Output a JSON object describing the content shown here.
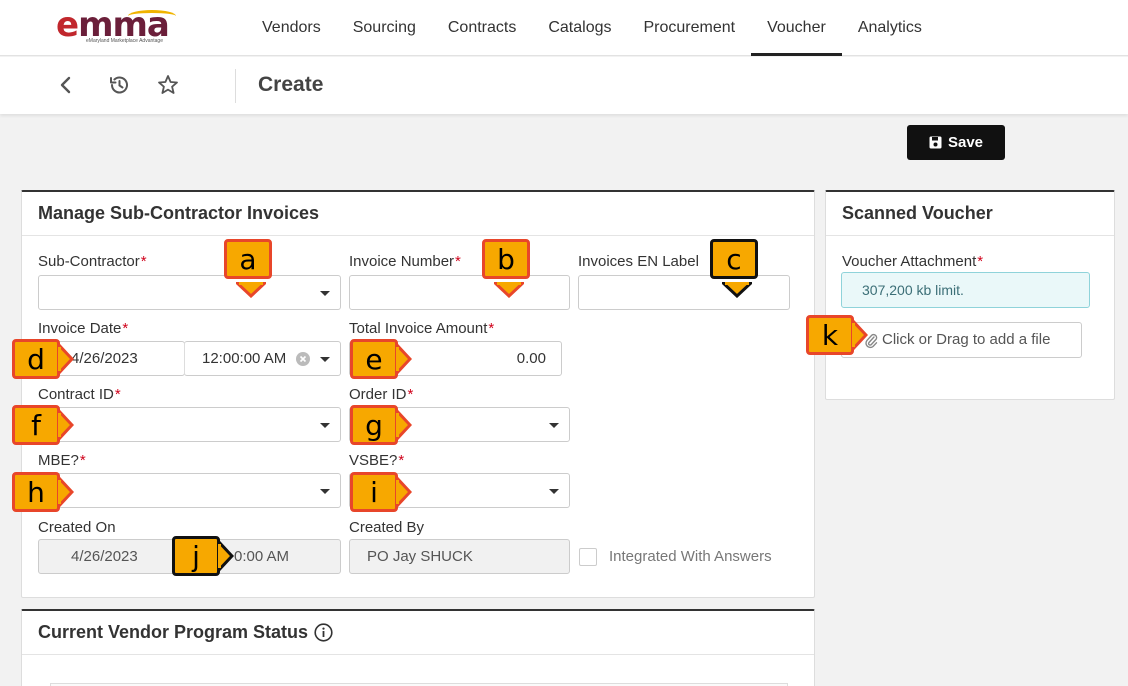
{
  "brand": {
    "logo_text_e": "e",
    "logo_text_rest": "mma",
    "logo_sub": "eMaryland Marketplace Advantage"
  },
  "nav": {
    "items": [
      "Vendors",
      "Sourcing",
      "Contracts",
      "Catalogs",
      "Procurement",
      "Voucher",
      "Analytics"
    ],
    "active": "Voucher"
  },
  "subheader": {
    "title": "Create"
  },
  "actions": {
    "save_label": "Save"
  },
  "invoice_panel": {
    "title": "Manage Sub-Contractor Invoices",
    "sub_contractor_label": "Sub-Contractor",
    "invoice_number_label": "Invoice Number",
    "invoices_en_label": "Invoices EN Label",
    "invoice_date_label": "Invoice Date",
    "invoice_date_value": "4/26/2023",
    "invoice_time_value": "12:00:00 AM",
    "total_amount_label": "Total Invoice Amount",
    "total_amount_value": "0.00",
    "contract_id_label": "Contract ID",
    "order_id_label": "Order ID",
    "mbe_label": "MBE?",
    "vsbe_label": "VSBE?",
    "created_on_label": "Created On",
    "created_on_date": "4/26/2023",
    "created_on_time": "0:00 AM",
    "created_by_label": "Created By",
    "created_by_value": "PO Jay SHUCK",
    "integrated_label": "Integrated With Answers",
    "required_mark": "*"
  },
  "scanned_panel": {
    "title": "Scanned Voucher",
    "attachment_label": "Voucher Attachment",
    "limit_text": "307,200 kb limit.",
    "drop_text": "Click or Drag to add a file"
  },
  "vendor_panel": {
    "title": "Current Vendor Program Status"
  },
  "callouts": [
    "a",
    "b",
    "c",
    "d",
    "e",
    "f",
    "g",
    "h",
    "i",
    "j",
    "k"
  ],
  "colors": {
    "callout_fill": "#f7a800",
    "callout_border_red": "#e8462a",
    "callout_border_black": "#111111",
    "required": "#d0021b",
    "save_bg": "#111111"
  }
}
